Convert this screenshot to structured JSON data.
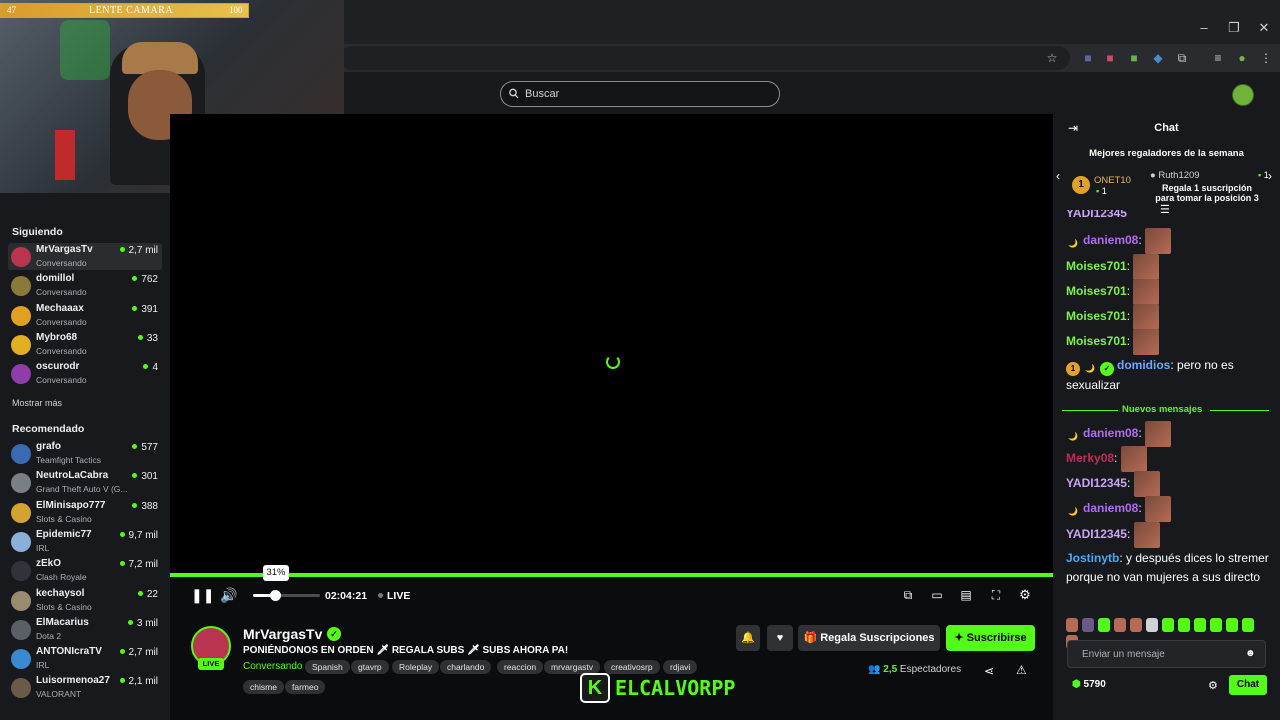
{
  "window_controls": {
    "minimize": "–",
    "maximize": "❐",
    "close": "✕"
  },
  "header": {
    "search_placeholder": "Buscar"
  },
  "webcam_overlay": {
    "level": "47",
    "title": "LENTE CAMARA",
    "value": "100",
    "fill_fraction": 1.0
  },
  "sidebar": {
    "following_title": "Siguiendo",
    "following": [
      {
        "name": "MrVargasTv",
        "sub": "Conversando",
        "viewers": "2,7 mil",
        "color": "#b8344f"
      },
      {
        "name": "domillol",
        "sub": "Conversando",
        "viewers": "762",
        "color": "#8a7a3a"
      },
      {
        "name": "Mechaaax",
        "sub": "Conversando",
        "viewers": "391",
        "color": "#e0a020"
      },
      {
        "name": "Mybro68",
        "sub": "Conversando",
        "viewers": "33",
        "color": "#e0b020"
      },
      {
        "name": "oscurodr",
        "sub": "Conversando",
        "viewers": "4",
        "color": "#8f3da8"
      }
    ],
    "show_more": "Mostrar más",
    "recommended_title": "Recomendado",
    "recommended": [
      {
        "name": "grafo",
        "sub": "Teamfight Tactics",
        "viewers": "577",
        "color": "#3a6ab0"
      },
      {
        "name": "NeutroLaCabra",
        "sub": "Grand Theft Auto V (G...",
        "viewers": "301",
        "color": "#7a7f86"
      },
      {
        "name": "ElMinisapo777",
        "sub": "Slots & Casino",
        "viewers": "388",
        "color": "#d2a330"
      },
      {
        "name": "Epidemic77",
        "sub": "IRL",
        "viewers": "9,7 mil",
        "color": "#8ab0d8"
      },
      {
        "name": "zEkO",
        "sub": "Clash Royale",
        "viewers": "7,2 mil",
        "color": "#30343a"
      },
      {
        "name": "kechaysol",
        "sub": "Slots & Casino",
        "viewers": "22",
        "color": "#9a8a70"
      },
      {
        "name": "ElMacarius",
        "sub": "Dota 2",
        "viewers": "3 mil",
        "color": "#5a5f66"
      },
      {
        "name": "ANTONIcraTV",
        "sub": "IRL",
        "viewers": "2,7 mil",
        "color": "#3a8ad0"
      },
      {
        "name": "Luisormenoa27",
        "sub": "VALORANT",
        "viewers": "2,1 mil",
        "color": "#6a5a4a"
      }
    ]
  },
  "player": {
    "volume_percent": 31,
    "volume_label": "31%",
    "time": "02:04:21",
    "live_label": "LIVE"
  },
  "stream": {
    "streamer": "MrVargasTv",
    "live_badge": "LIVE",
    "title": "PONIÉNDONOS EN ORDEN 🗡 REGALA SUBS 🗡 SUBS AHORA PA!",
    "category": "Conversando",
    "tags": [
      "Spanish",
      "gtavrp",
      "Roleplay",
      "charlando",
      "reaccion",
      "mrvargastv",
      "creativosrp",
      "rdjavi",
      "chisme",
      "farmeo"
    ],
    "gift_button": "Regala Suscripciones",
    "subscribe_button": "Suscribirse",
    "viewers_label": "Espectadores",
    "viewers_count": "2,5"
  },
  "watermark": {
    "letter": "K",
    "text": "ELCALVORPP"
  },
  "chat": {
    "title": "Chat",
    "top_gifters_title": "Mejores regaladores de la semana",
    "gifters": [
      {
        "rank": "1",
        "name": "ONET10",
        "count": "1"
      },
      {
        "name": "Ruth1209",
        "count": "1"
      }
    ],
    "gift_cta": "Regala 1 suscripción para tomar la posición 3",
    "partial_user": "YADI12345",
    "messages": [
      {
        "user": "daniem08",
        "color": "#b36af0",
        "text": ""
      },
      {
        "user": "Moises701",
        "color": "#7ef24a",
        "text": ""
      },
      {
        "user": "Moises701",
        "color": "#7ef24a",
        "text": ""
      },
      {
        "user": "Moises701",
        "color": "#7ef24a",
        "text": ""
      },
      {
        "user": "Moises701",
        "color": "#7ef24a",
        "text": ""
      },
      {
        "user": "domidios",
        "color": "#6aa8ff",
        "text": "pero no es sexualizar"
      }
    ],
    "new_messages_label": "Nuevos mensajes",
    "new_messages": [
      {
        "user": "daniem08",
        "color": "#b36af0",
        "text": ""
      },
      {
        "user": "Merky08",
        "color": "#c02a58",
        "text": ""
      },
      {
        "user": "YADI12345",
        "color": "#c9a6f5",
        "text": ""
      },
      {
        "user": "daniem08",
        "color": "#b36af0",
        "text": ""
      },
      {
        "user": "YADI12345",
        "color": "#c9a6f5",
        "text": ""
      },
      {
        "user": "Jostinytb",
        "color": "#4aa8f0",
        "text": "y después dices lo stremer porque no van mujeres a sus directo"
      }
    ],
    "input_placeholder": "Enviar un mensaje",
    "points": "5790",
    "send_button": "Chat"
  },
  "colors": {
    "accent": "#53fc18",
    "background": "#0c0d0f",
    "panel": "#18191c"
  }
}
